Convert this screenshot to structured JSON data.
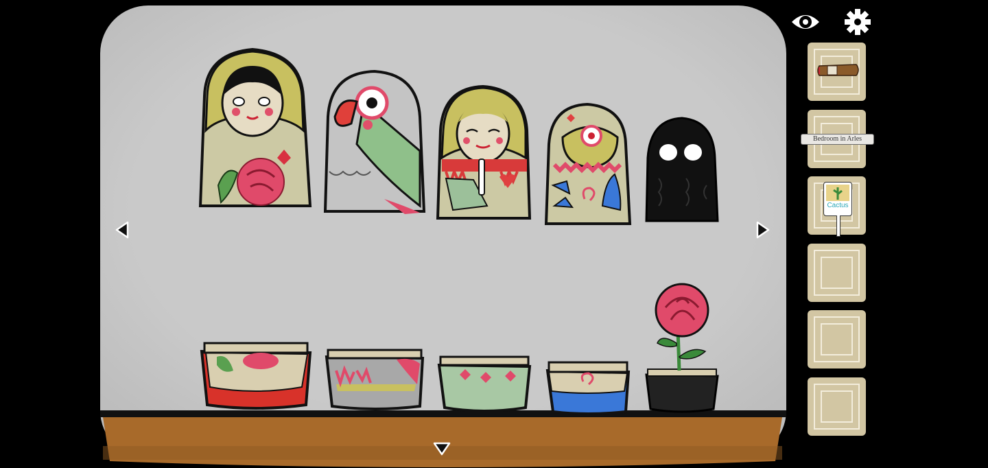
{
  "colors": {
    "wall": "#c8c8c8",
    "shelf": "#a86a2a",
    "frame": "#000000",
    "slot_bg": "#d2c6a3",
    "slot_line": "#f3eddc"
  },
  "icons": {
    "eye": "eye-icon",
    "settings": "gear-icon",
    "left": "arrow-left-icon",
    "right": "arrow-right-icon",
    "down": "arrow-down-icon"
  },
  "inventory": {
    "slot_count": 6,
    "items": [
      {
        "slot": 1,
        "item": "cigar-icon"
      },
      {
        "slot": 2,
        "label": "Bedroom in Arles"
      },
      {
        "slot": 3,
        "label": "Cactus"
      }
    ]
  },
  "scene": {
    "dolls_top": [
      "girl-doll-icon",
      "parrot-doll-icon",
      "girl-knife-doll-icon",
      "owl-doll-icon",
      "shadow-doll-icon"
    ],
    "doll_bottoms": [
      "red-rose-bottom-icon",
      "grey-bottom-icon",
      "green-bottom-icon",
      "blue-bottom-icon"
    ],
    "pot": "rose-pot-icon"
  }
}
